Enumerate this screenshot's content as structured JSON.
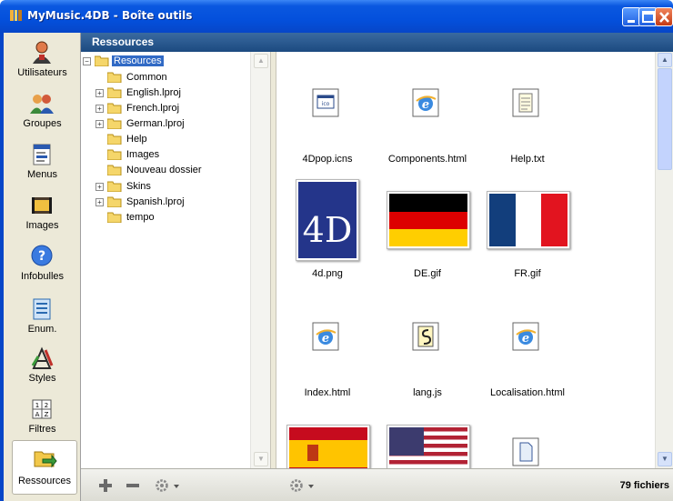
{
  "window": {
    "title": "MyMusic.4DB - Boîte outils"
  },
  "sidebar": {
    "items": [
      {
        "label": "Utilisateurs",
        "icon": "users-icon"
      },
      {
        "label": "Groupes",
        "icon": "groups-icon"
      },
      {
        "label": "Menus",
        "icon": "menus-icon"
      },
      {
        "label": "Images",
        "icon": "images-icon"
      },
      {
        "label": "Infobulles",
        "icon": "tooltip-icon"
      },
      {
        "label": "Enum.",
        "icon": "enum-icon"
      },
      {
        "label": "Styles",
        "icon": "styles-icon"
      },
      {
        "label": "Filtres",
        "icon": "filters-icon"
      },
      {
        "label": "Ressources",
        "icon": "resources-icon",
        "active": true
      }
    ]
  },
  "header": {
    "title": "Ressources"
  },
  "tree": {
    "root": "Resources",
    "items": [
      {
        "label": "Common",
        "expandable": false
      },
      {
        "label": "English.lproj",
        "expandable": true
      },
      {
        "label": "French.lproj",
        "expandable": true
      },
      {
        "label": "German.lproj",
        "expandable": true
      },
      {
        "label": "Help",
        "expandable": false
      },
      {
        "label": "Images",
        "expandable": false
      },
      {
        "label": "Nouveau dossier",
        "expandable": false
      },
      {
        "label": "Skins",
        "expandable": true
      },
      {
        "label": "Spanish.lproj",
        "expandable": true
      },
      {
        "label": "tempo",
        "expandable": false
      }
    ]
  },
  "files": [
    {
      "name": "4Dpop.icns"
    },
    {
      "name": "Components.html"
    },
    {
      "name": "Help.txt"
    },
    {
      "name": "4d.png"
    },
    {
      "name": "DE.gif"
    },
    {
      "name": "FR.gif"
    },
    {
      "name": "Index.html"
    },
    {
      "name": "lang.js"
    },
    {
      "name": "Localisation.html"
    },
    {
      "name": ""
    },
    {
      "name": ""
    },
    {
      "name": ""
    }
  ],
  "images": {
    "logo_text": "4D"
  },
  "footer": {
    "file_count": "79 fichiers"
  },
  "colors": {
    "titlebar": "#0450dc",
    "header": "#2a5a90",
    "selection": "#316ac5"
  }
}
